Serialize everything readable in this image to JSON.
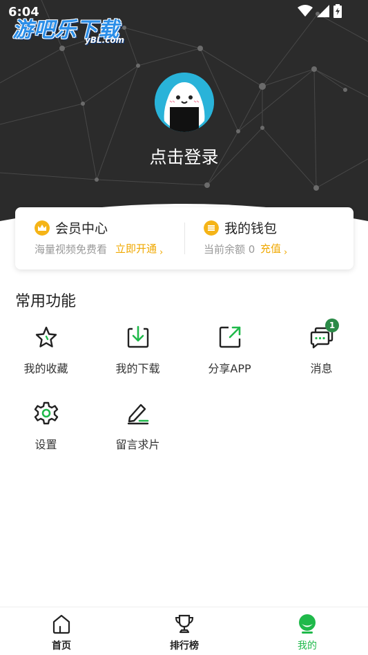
{
  "status_bar": {
    "time": "6:04",
    "icons": [
      "wifi-icon",
      "signal-icon",
      "battery-charging-icon"
    ]
  },
  "watermark": {
    "title": "游吧乐下载",
    "domain": "yBL.com"
  },
  "profile": {
    "avatar_icon": "onigiri-avatar-icon",
    "login_text": "点击登录"
  },
  "member_card": {
    "vip": {
      "icon": "crown-icon",
      "title": "会员中心",
      "subtitle": "海量视频免费看",
      "action": "立即开通"
    },
    "wallet": {
      "icon": "coin-icon",
      "title": "我的钱包",
      "subtitle": "当前余额 0",
      "action": "充值"
    }
  },
  "features": {
    "section_title": "常用功能",
    "items": [
      {
        "label": "我的收藏",
        "icon": "star-icon"
      },
      {
        "label": "我的下载",
        "icon": "download-icon"
      },
      {
        "label": "分享APP",
        "icon": "share-icon"
      },
      {
        "label": "消息",
        "icon": "message-icon",
        "badge": "1"
      },
      {
        "label": "设置",
        "icon": "gear-icon"
      },
      {
        "label": "留言求片",
        "icon": "edit-icon"
      }
    ]
  },
  "tabbar": {
    "tabs": [
      {
        "label": "首页",
        "icon": "home-icon",
        "active": false
      },
      {
        "label": "排行榜",
        "icon": "trophy-icon",
        "active": false
      },
      {
        "label": "我的",
        "icon": "profile-icon",
        "active": true
      }
    ]
  },
  "colors": {
    "accent_green": "#1fb94a",
    "gold": "#f0a800",
    "header_dark": "#2a2a2a",
    "avatar_blue": "#29b3d9"
  }
}
